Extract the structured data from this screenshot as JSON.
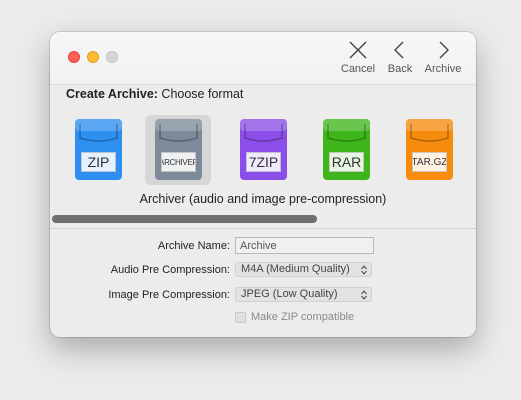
{
  "toolbar": {
    "cancel_label": "Cancel",
    "back_label": "Back",
    "archive_label": "Archive"
  },
  "header": {
    "title_bold": "Create Archive:",
    "title_rest": "Choose format"
  },
  "formats": [
    {
      "label": "ZIP",
      "color": "#2d8ff0",
      "selected": false
    },
    {
      "label": "ARCHIVER",
      "color": "#7d8a9a",
      "selected": true
    },
    {
      "label": "7ZIP",
      "color": "#8b4ee8",
      "selected": false
    },
    {
      "label": "RAR",
      "color": "#3fb51c",
      "selected": false
    },
    {
      "label": "TAR.GZ",
      "color": "#f68b0e",
      "selected": false
    }
  ],
  "selected_description": "Archiver (audio and image pre-compression)",
  "form": {
    "archive_name_label": "Archive Name:",
    "archive_name_value": "Archive",
    "audio_label": "Audio Pre Compression:",
    "audio_value": "M4A (Medium Quality)",
    "image_label": "Image Pre Compression:",
    "image_value": "JPEG (Low Quality)",
    "zip_compatible_label": "Make ZIP compatible"
  }
}
